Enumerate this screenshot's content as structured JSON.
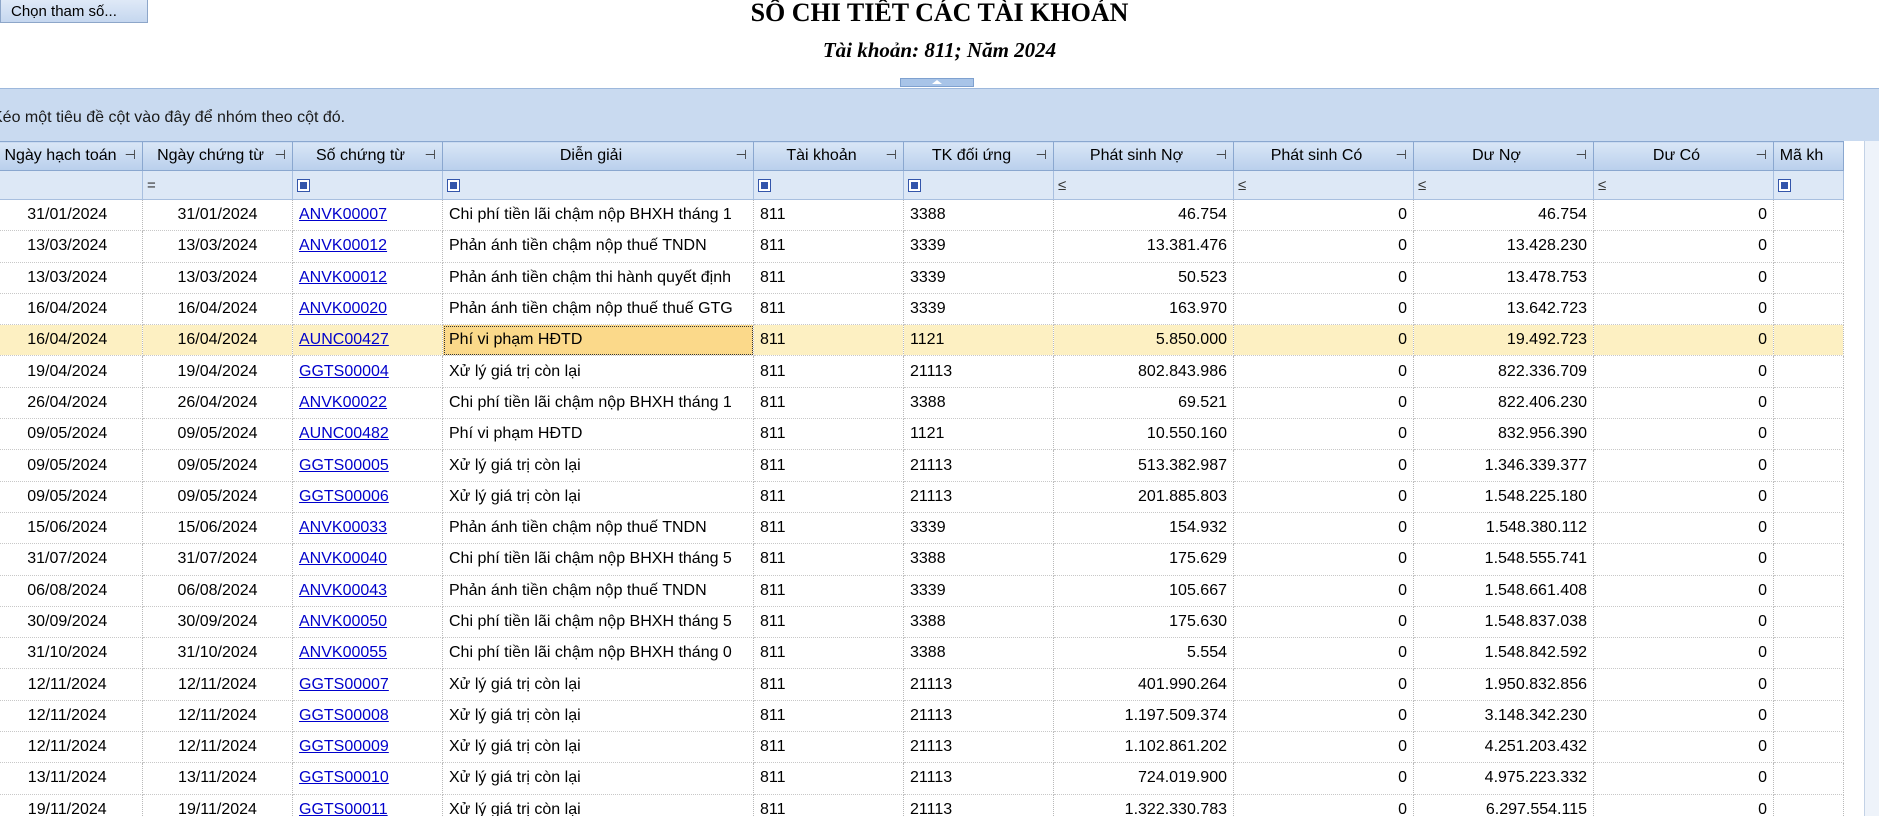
{
  "toolbar": {
    "param_button": "Chọn tham số..."
  },
  "report": {
    "title": "SỔ CHI TIẾT CÁC TÀI KHOẢN",
    "subtitle": "Tài khoản: 811; Năm 2024"
  },
  "grid": {
    "group_hint": "Kéo một tiêu đề cột vào đây để nhóm theo cột đó.",
    "columns": [
      "Ngày hạch toán",
      "Ngày chứng từ",
      "Số chứng từ",
      "Diễn giải",
      "Tài khoản",
      "TK đối ứng",
      "Phát sinh Nợ",
      "Phát sinh Có",
      "Dư Nợ",
      "Dư Có",
      "Mã kh"
    ],
    "filters": [
      "",
      "=",
      "chk",
      "chk",
      "chk",
      "chk",
      "≤",
      "≤",
      "≤",
      "≤",
      "chk"
    ],
    "selected_row": 4,
    "rows": [
      [
        "31/01/2024",
        "31/01/2024",
        "ANVK00007",
        "Chi phí tiền lãi chậm nộp BHXH tháng 1",
        "811",
        "3388",
        "46.754",
        "0",
        "46.754",
        "0",
        ""
      ],
      [
        "13/03/2024",
        "13/03/2024",
        "ANVK00012",
        "Phản ánh tiền chậm nộp thuế TNDN",
        "811",
        "3339",
        "13.381.476",
        "0",
        "13.428.230",
        "0",
        ""
      ],
      [
        "13/03/2024",
        "13/03/2024",
        "ANVK00012",
        "Phản ánh tiền chậm thi hành quyết định",
        "811",
        "3339",
        "50.523",
        "0",
        "13.478.753",
        "0",
        ""
      ],
      [
        "16/04/2024",
        "16/04/2024",
        "ANVK00020",
        "Phản ánh tiền chậm nộp thuế thuế GTG",
        "811",
        "3339",
        "163.970",
        "0",
        "13.642.723",
        "0",
        ""
      ],
      [
        "16/04/2024",
        "16/04/2024",
        "AUNC00427",
        "Phí vi phạm HĐTD",
        "811",
        "1121",
        "5.850.000",
        "0",
        "19.492.723",
        "0",
        ""
      ],
      [
        "19/04/2024",
        "19/04/2024",
        "GGTS00004",
        "Xử lý giá trị còn lại",
        "811",
        "21113",
        "802.843.986",
        "0",
        "822.336.709",
        "0",
        ""
      ],
      [
        "26/04/2024",
        "26/04/2024",
        "ANVK00022",
        "Chi phí tiền lãi chậm nộp BHXH tháng 1",
        "811",
        "3388",
        "69.521",
        "0",
        "822.406.230",
        "0",
        ""
      ],
      [
        "09/05/2024",
        "09/05/2024",
        "AUNC00482",
        "Phí vi phạm HĐTD",
        "811",
        "1121",
        "10.550.160",
        "0",
        "832.956.390",
        "0",
        ""
      ],
      [
        "09/05/2024",
        "09/05/2024",
        "GGTS00005",
        "Xử lý giá trị còn lại",
        "811",
        "21113",
        "513.382.987",
        "0",
        "1.346.339.377",
        "0",
        ""
      ],
      [
        "09/05/2024",
        "09/05/2024",
        "GGTS00006",
        "Xử lý giá trị còn lại",
        "811",
        "21113",
        "201.885.803",
        "0",
        "1.548.225.180",
        "0",
        ""
      ],
      [
        "15/06/2024",
        "15/06/2024",
        "ANVK00033",
        "Phản ánh tiền chậm nộp thuế TNDN",
        "811",
        "3339",
        "154.932",
        "0",
        "1.548.380.112",
        "0",
        ""
      ],
      [
        "31/07/2024",
        "31/07/2024",
        "ANVK00040",
        "Chi phí tiền lãi chậm nộp BHXH tháng 5",
        "811",
        "3388",
        "175.629",
        "0",
        "1.548.555.741",
        "0",
        ""
      ],
      [
        "06/08/2024",
        "06/08/2024",
        "ANVK00043",
        "Phản ánh tiền chậm nộp thuế TNDN",
        "811",
        "3339",
        "105.667",
        "0",
        "1.548.661.408",
        "0",
        ""
      ],
      [
        "30/09/2024",
        "30/09/2024",
        "ANVK00050",
        "Chi phí tiền lãi chậm nộp BHXH tháng 5",
        "811",
        "3388",
        "175.630",
        "0",
        "1.548.837.038",
        "0",
        ""
      ],
      [
        "31/10/2024",
        "31/10/2024",
        "ANVK00055",
        "Chi phí tiền lãi chậm nộp BHXH tháng 0",
        "811",
        "3388",
        "5.554",
        "0",
        "1.548.842.592",
        "0",
        ""
      ],
      [
        "12/11/2024",
        "12/11/2024",
        "GGTS00007",
        "Xử lý giá trị còn lại",
        "811",
        "21113",
        "401.990.264",
        "0",
        "1.950.832.856",
        "0",
        ""
      ],
      [
        "12/11/2024",
        "12/11/2024",
        "GGTS00008",
        "Xử lý giá trị còn lại",
        "811",
        "21113",
        "1.197.509.374",
        "0",
        "3.148.342.230",
        "0",
        ""
      ],
      [
        "12/11/2024",
        "12/11/2024",
        "GGTS00009",
        "Xử lý giá trị còn lại",
        "811",
        "21113",
        "1.102.861.202",
        "0",
        "4.251.203.432",
        "0",
        ""
      ],
      [
        "13/11/2024",
        "13/11/2024",
        "GGTS00010",
        "Xử lý giá trị còn lại",
        "811",
        "21113",
        "724.019.900",
        "0",
        "4.975.223.332",
        "0",
        ""
      ],
      [
        "19/11/2024",
        "19/11/2024",
        "GGTS00011",
        "Xử lý giá trị còn lại",
        "811",
        "21113",
        "1.322.330.783",
        "0",
        "6.297.554.115",
        "0",
        ""
      ]
    ]
  }
}
